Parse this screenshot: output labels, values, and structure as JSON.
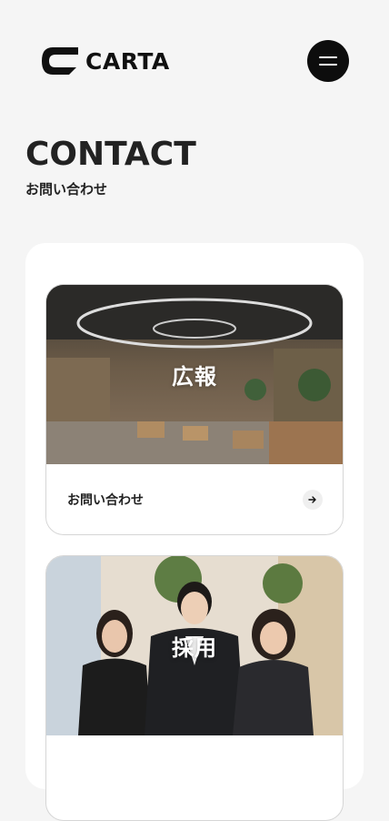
{
  "header": {
    "logo_text": "CARTA",
    "menu_icon": "hamburger-menu-icon"
  },
  "page": {
    "title": "CONTACT",
    "subtitle": "お問い合わせ"
  },
  "cards": [
    {
      "image_label": "広報",
      "footer_label": "お問い合わせ",
      "arrow_icon": "arrow-right-icon"
    },
    {
      "image_label": "採用"
    }
  ],
  "colors": {
    "background": "#f5f5f5",
    "panel": "#ffffff",
    "menu_button": "#0d0d0d",
    "text": "#222222"
  }
}
